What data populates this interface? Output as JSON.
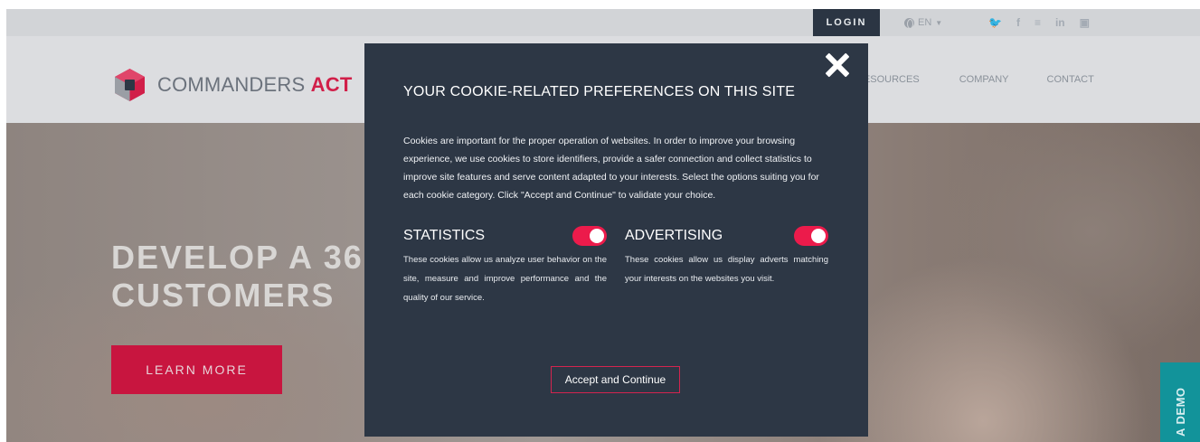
{
  "topbar": {
    "login_label": "LOGIN",
    "language_label": "EN",
    "social": [
      "twitter-icon",
      "facebook-icon",
      "youtube-icon",
      "linkedin-icon",
      "instagram-icon"
    ],
    "social_glyphs": [
      "🐦",
      "f",
      "≡",
      "in",
      "▣"
    ]
  },
  "nav": {
    "brand_part1": "COMMANDERS",
    "brand_part2": "ACT",
    "links": [
      "RESOURCES",
      "COMPANY",
      "CONTACT"
    ],
    "brand_color": "#d11f49"
  },
  "hero": {
    "title_line1": "DEVELOP A 36",
    "title_line2": "CUSTOMERS",
    "learn_more_label": "LEARN MORE",
    "demo_tab_label": "A DEMO"
  },
  "modal": {
    "title": "YOUR COOKIE-RELATED PREFERENCES ON THIS SITE",
    "body": "Cookies are important for the proper operation of websites. In order to improve your browsing experience, we use cookies to store identifiers, provide a safer connection and collect statistics to improve site features and serve content adapted to your interests. Select the options suiting you for each cookie category. Click \"Accept and Continue\" to validate your choice.",
    "categories": [
      {
        "name": "STATISTICS",
        "enabled": true,
        "description": "These cookies allow us analyze user behavior on the site, measure and improve performance and the quality of our service."
      },
      {
        "name": "ADVERTISING",
        "enabled": true,
        "description": "These cookies allow us display adverts matching your interests on the websites you visit."
      }
    ],
    "accept_label": "Accept and Continue",
    "background_color": "#2d3745",
    "accent_color": "#ec1b4b"
  }
}
